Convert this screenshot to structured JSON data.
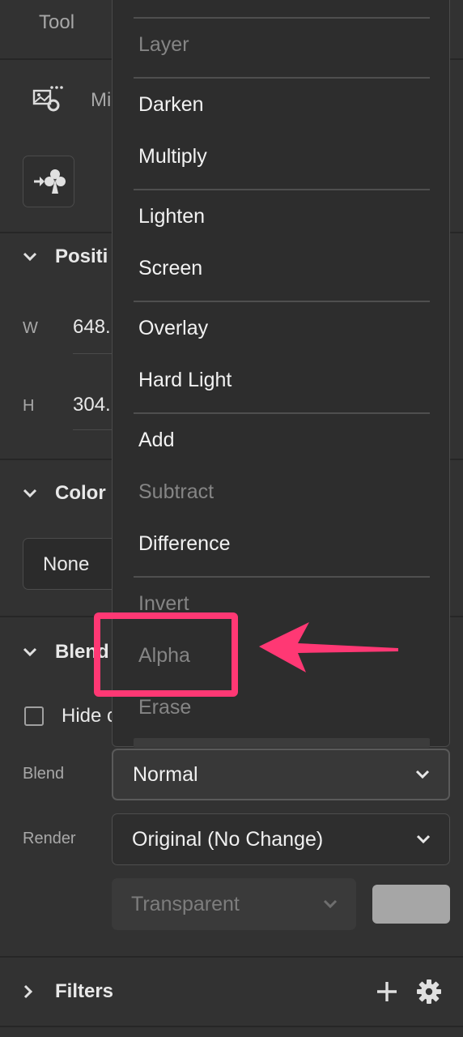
{
  "panel": {
    "tool_tab": "Tool",
    "mini_label": "Mi",
    "position_title": "Positi",
    "w_label": "W",
    "w_value": "648.",
    "h_label": "H",
    "h_value": "304.",
    "color_title": "Color",
    "color_value": "None",
    "blend_title": "Blend",
    "hide_label": "Hide c",
    "blend_label": "Blend",
    "blend_value": "Normal",
    "render_label": "Render",
    "render_value": "Original (No Change)",
    "transparent_value": "Transparent",
    "filters_title": "Filters"
  },
  "blend_menu": {
    "items": [
      {
        "label": "Layer",
        "enabled": false
      },
      {
        "label": "Darken",
        "enabled": true
      },
      {
        "label": "Multiply",
        "enabled": true
      },
      {
        "label": "Lighten",
        "enabled": true
      },
      {
        "label": "Screen",
        "enabled": true
      },
      {
        "label": "Overlay",
        "enabled": true
      },
      {
        "label": "Hard Light",
        "enabled": true
      },
      {
        "label": "Add",
        "enabled": true
      },
      {
        "label": "Subtract",
        "enabled": false
      },
      {
        "label": "Difference",
        "enabled": true
      },
      {
        "label": "Invert",
        "enabled": false
      },
      {
        "label": "Alpha",
        "enabled": false
      },
      {
        "label": "Erase",
        "enabled": false
      }
    ]
  },
  "colors": {
    "annotation": "#ff3874",
    "panel_bg": "#323232",
    "menu_bg": "#2d2d2d"
  }
}
